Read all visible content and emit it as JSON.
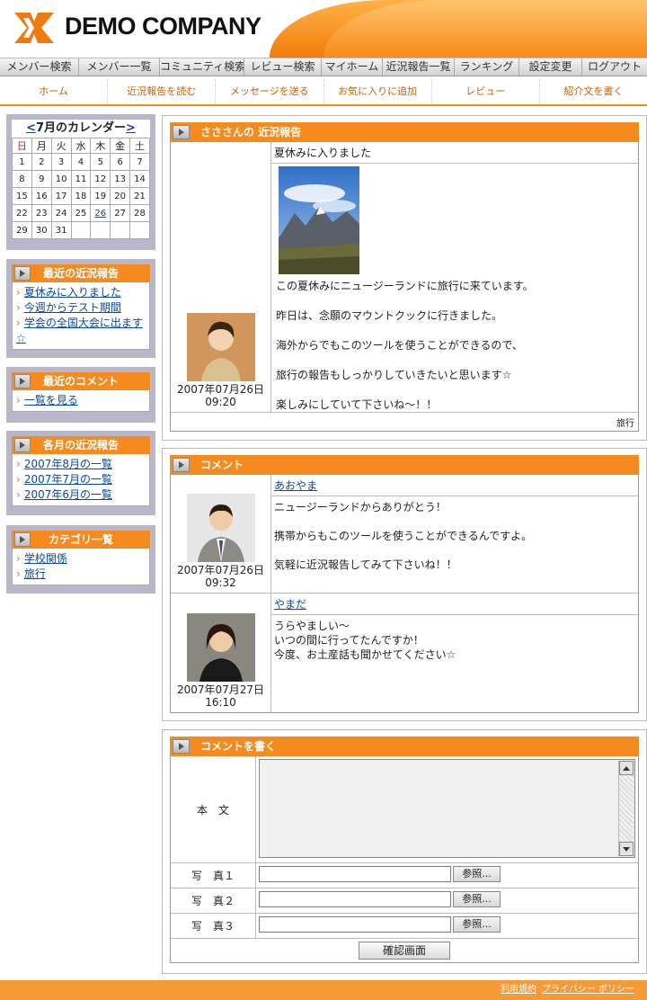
{
  "header": {
    "company": "DEMO COMPANY"
  },
  "topnav": [
    "メンバー検索",
    "メンバー一覧",
    "コミュニティ検索",
    "レビュー検索",
    "マイホーム",
    "近況報告一覧",
    "ランキング",
    "設定変更",
    "ログアウト"
  ],
  "subnav": [
    "ホーム",
    "近況報告を読む",
    "メッセージを送る",
    "お気に入りに追加",
    "レビュー",
    "紹介文を書く"
  ],
  "calendar": {
    "prev": "<",
    "title": "7月のカレンダー",
    "next": ">",
    "days": [
      "日",
      "月",
      "火",
      "水",
      "木",
      "金",
      "土"
    ],
    "weeks": [
      [
        "1",
        "2",
        "3",
        "4",
        "5",
        "6",
        "7"
      ],
      [
        "8",
        "9",
        "10",
        "11",
        "12",
        "13",
        "14"
      ],
      [
        "15",
        "16",
        "17",
        "18",
        "19",
        "20",
        "21"
      ],
      [
        "22",
        "23",
        "24",
        "25",
        "26",
        "27",
        "28"
      ],
      [
        "29",
        "30",
        "31",
        "",
        "",
        "",
        ""
      ]
    ],
    "linked_day": "26"
  },
  "sidebar": {
    "recent_reports": {
      "title": "最近の近況報告",
      "items": [
        "夏休みに入りました",
        "今週からテスト期間",
        "学会の全国大会に出ます☆"
      ]
    },
    "recent_comments": {
      "title": "最近のコメント",
      "items": [
        "一覧を見る"
      ]
    },
    "monthly": {
      "title": "各月の近況報告",
      "items": [
        "2007年8月の一覧",
        "2007年7月の一覧",
        "2007年6月の一覧"
      ]
    },
    "categories": {
      "title": "カテゴリ一覧",
      "items": [
        "学校関係",
        "旅行"
      ]
    }
  },
  "report": {
    "title": "さささんの 近況報告",
    "subject": "夏休みに入りました",
    "date": "2007年07月26日",
    "time": "09:20",
    "body": [
      "この夏休みにニュージーランドに旅行に来ています。",
      "",
      "昨日は、念願のマウントクックに行きました。",
      "",
      "海外からでもこのツールを使うことができるので、",
      "",
      "旅行の報告もしっかりしていきたいと思います☆",
      "",
      "楽しみにしていて下さいね～！！"
    ],
    "category": "旅行"
  },
  "comments": {
    "title": "コメント",
    "items": [
      {
        "name": "あおやま",
        "date": "2007年07月26日",
        "time": "09:32",
        "body": [
          "ニュージーランドからありがとう！",
          "",
          "携帯からもこのツールを使うことができるんですよ。",
          "",
          "気軽に近況報告してみて下さいね！！"
        ]
      },
      {
        "name": "やまだ",
        "date": "2007年07月27日",
        "time": "16:10",
        "body": [
          "うらやましい～",
          "いつの間に行ってたんですか！",
          "今度、お土産話も聞かせてください☆"
        ]
      }
    ]
  },
  "form": {
    "title": "コメントを書く",
    "body_label": "本　文",
    "photo1": "写　真１",
    "photo2": "写　真２",
    "photo3": "写　真３",
    "browse": "参照...",
    "confirm": "確認画面"
  },
  "footer": {
    "terms": "利用規約",
    "privacy": "プライバシー ポリシー"
  }
}
